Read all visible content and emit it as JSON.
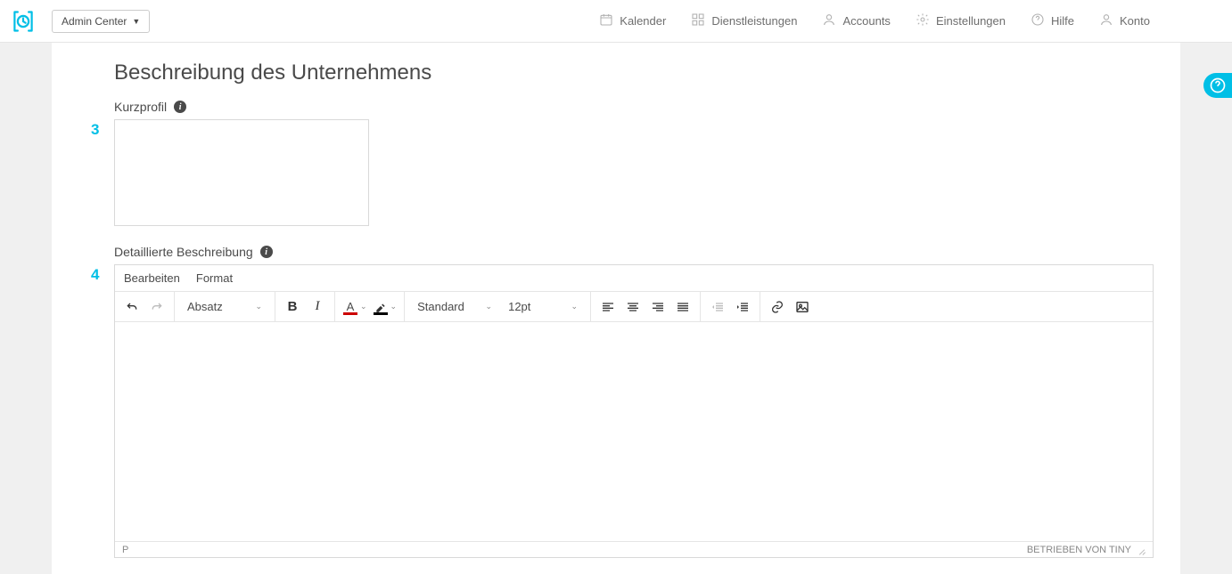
{
  "header": {
    "admin_center_label": "Admin Center",
    "nav": {
      "kalender": "Kalender",
      "dienstleistungen": "Dienstleistungen",
      "accounts": "Accounts",
      "einstellungen": "Einstellungen",
      "hilfe": "Hilfe",
      "konto": "Konto"
    }
  },
  "page": {
    "title": "Beschreibung des Unternehmens"
  },
  "shortprofile": {
    "step": "3",
    "label": "Kurzprofil",
    "value": ""
  },
  "detailed": {
    "step": "4",
    "label": "Detaillierte Beschreibung"
  },
  "editor": {
    "menu": {
      "edit": "Bearbeiten",
      "format": "Format"
    },
    "toolbar": {
      "block_format": "Absatz",
      "font_family": "Standard",
      "font_size": "12pt"
    },
    "status": {
      "path": "P",
      "powered": "BETRIEBEN VON TINY"
    }
  }
}
